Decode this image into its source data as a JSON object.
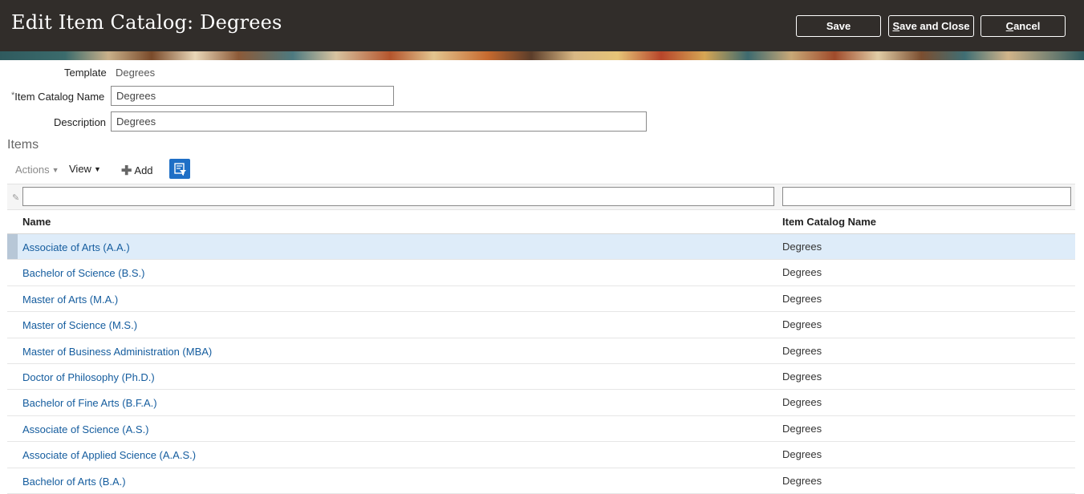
{
  "header": {
    "title": "Edit Item Catalog: Degrees",
    "save_label": "Save",
    "save_close_prefix": "S",
    "save_close_rest": "ave and Close",
    "cancel_prefix": "C",
    "cancel_rest": "ancel"
  },
  "form": {
    "template_label": "Template",
    "template_value": "Degrees",
    "required_marker": "*",
    "catalog_name_label": "Item Catalog Name",
    "catalog_name_value": "Degrees",
    "description_label": "Description",
    "description_value": "Degrees"
  },
  "items": {
    "section_title": "Items",
    "toolbar": {
      "actions_label": "Actions",
      "view_label": "View",
      "add_label": "Add"
    },
    "columns": {
      "name": "Name",
      "catalog_name": "Item Catalog Name"
    },
    "rows": [
      {
        "name": "Associate of Arts (A.A.)",
        "catalog": "Degrees"
      },
      {
        "name": "Bachelor of Science (B.S.)",
        "catalog": "Degrees"
      },
      {
        "name": "Master of Arts (M.A.)",
        "catalog": "Degrees"
      },
      {
        "name": "Master of Science (M.S.)",
        "catalog": "Degrees"
      },
      {
        "name": "Master of Business Administration (MBA)",
        "catalog": "Degrees"
      },
      {
        "name": "Doctor of Philosophy (Ph.D.)",
        "catalog": "Degrees"
      },
      {
        "name": "Bachelor of Fine Arts (B.F.A.)",
        "catalog": "Degrees"
      },
      {
        "name": "Associate of Science (A.S.)",
        "catalog": "Degrees"
      },
      {
        "name": "Associate of Applied Science (A.A.S.)",
        "catalog": "Degrees"
      },
      {
        "name": "Bachelor of Arts (B.A.)",
        "catalog": "Degrees"
      }
    ]
  },
  "colors": {
    "header_bg": "#312d2a",
    "link": "#145c9e",
    "selected_row": "#deecf9",
    "qbe_button": "#1f6fc6"
  }
}
